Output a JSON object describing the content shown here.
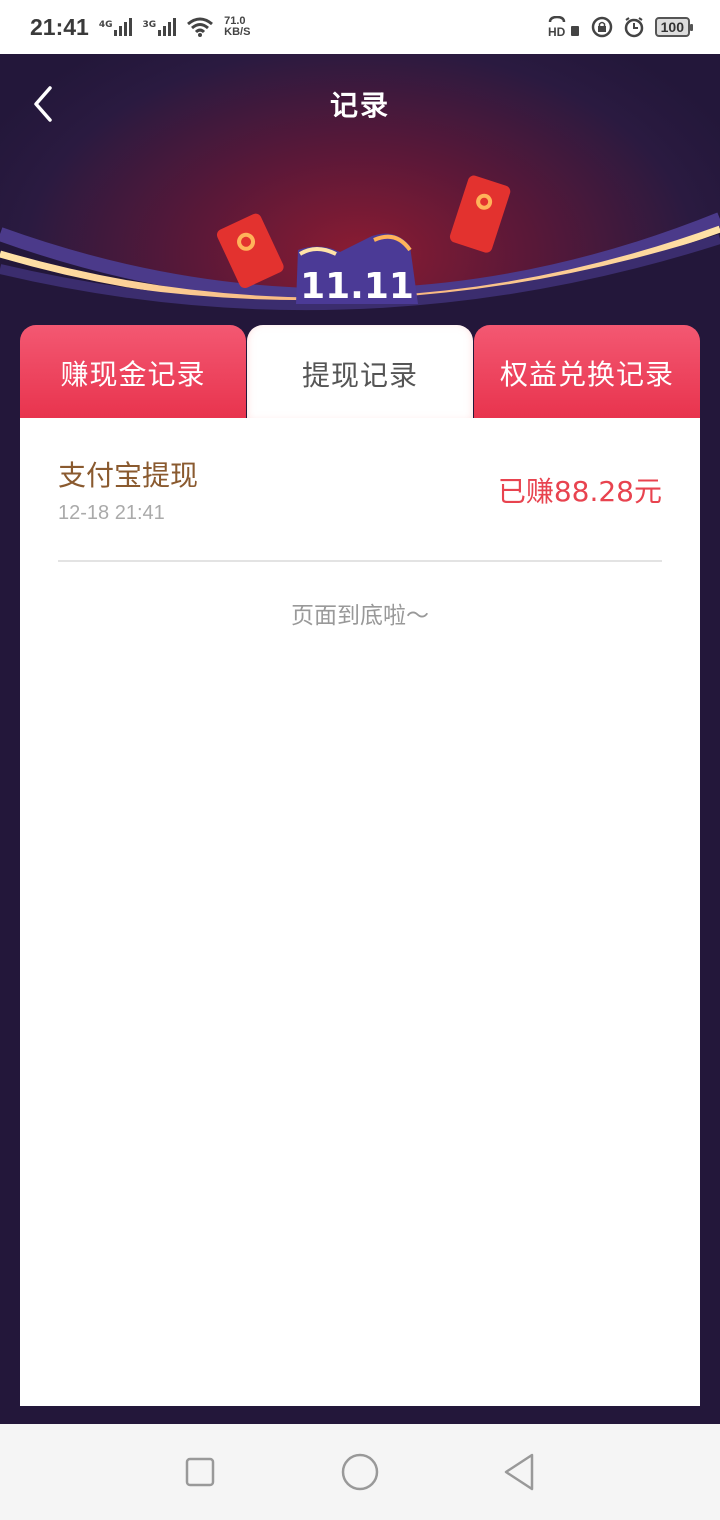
{
  "status_bar": {
    "time": "21:41",
    "net1": "4G",
    "net2": "3G",
    "speed_value": "71.0",
    "speed_unit": "KB/S",
    "battery": "100"
  },
  "header": {
    "title": "记录",
    "back_icon": "chevron-left-icon",
    "banner_text": "11.11"
  },
  "tabs": [
    {
      "label": "赚现金记录",
      "active": false
    },
    {
      "label": "提现记录",
      "active": true
    },
    {
      "label": "权益兑换记录",
      "active": false
    }
  ],
  "records": [
    {
      "title": "支付宝提现",
      "time": "12-18 21:41",
      "amount": "已赚88.28元"
    }
  ],
  "end_text": "页面到底啦～",
  "colors": {
    "background": "#23173a",
    "tab_red": "#e8334d",
    "amount_red": "#e8434f",
    "title_brown": "#8a5a2f"
  },
  "nav": {
    "recent_icon": "square-icon",
    "home_icon": "circle-icon",
    "back_icon": "triangle-back-icon"
  }
}
